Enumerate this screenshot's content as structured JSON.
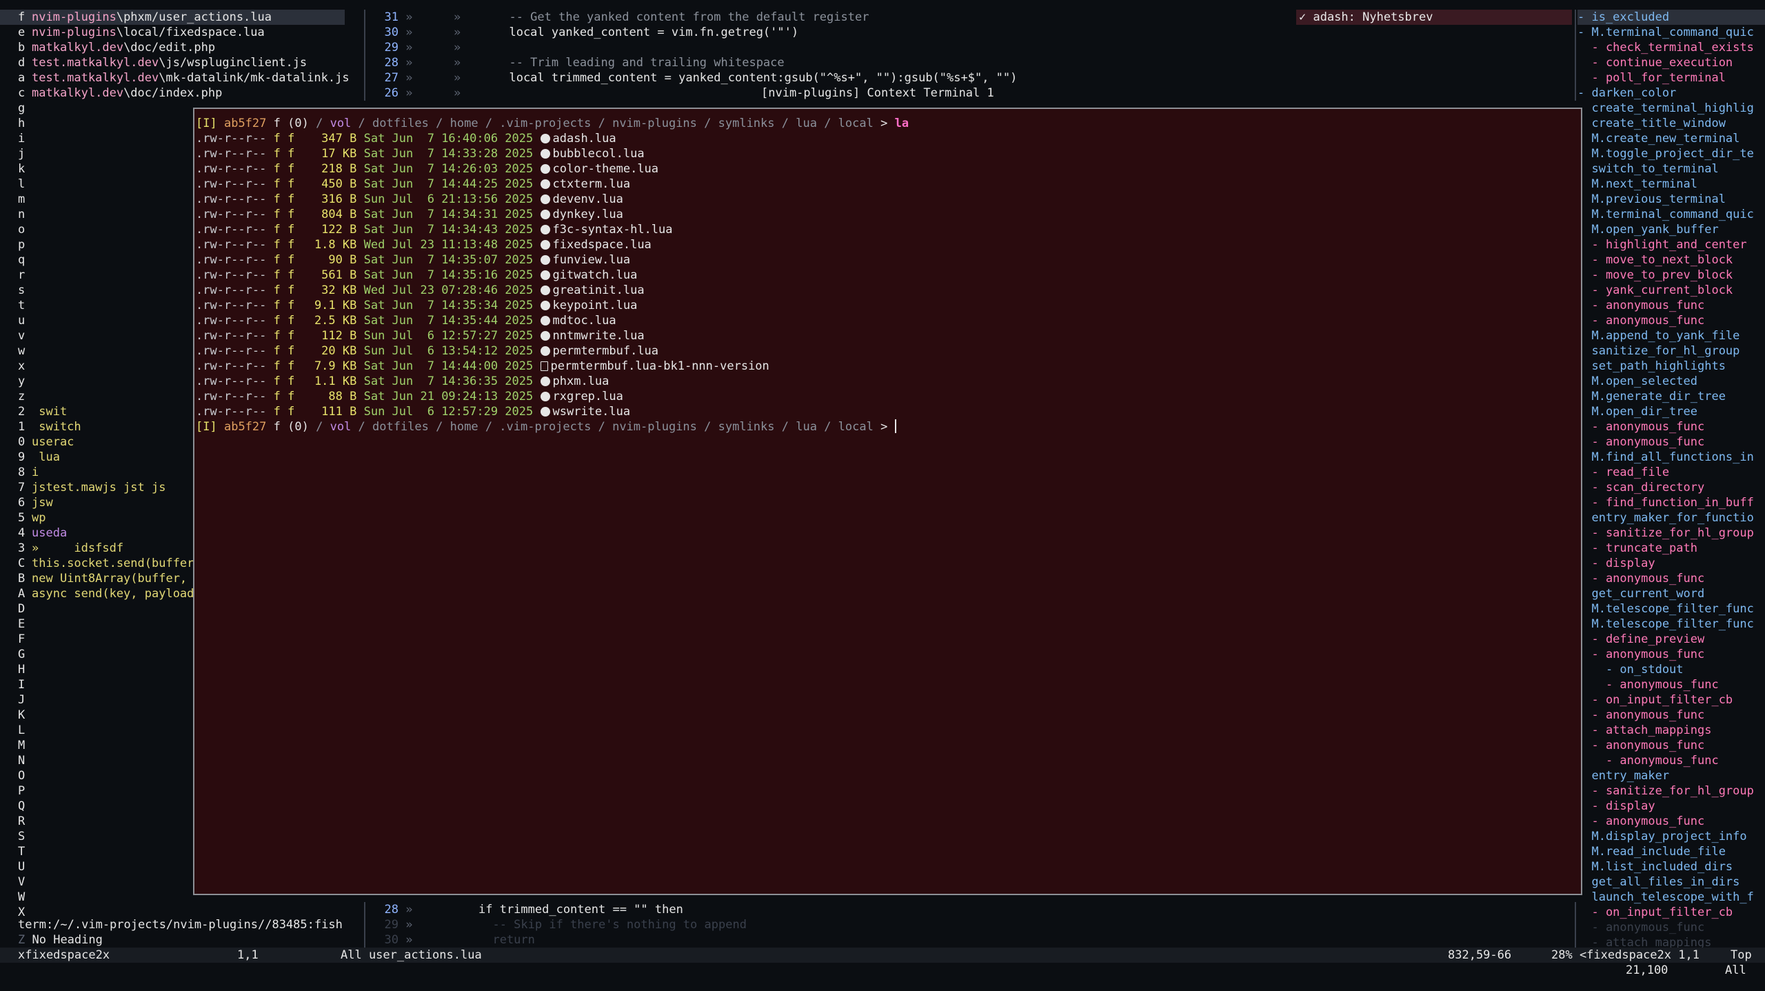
{
  "left_buffers": [
    {
      "key": "f",
      "path_a": "nvim-plugins",
      "path_b": "\\phxm/user_actions.lua",
      "selected": true
    },
    {
      "key": "e",
      "path_a": "nvim-plugins",
      "path_b": "\\local/fixedspace.lua"
    },
    {
      "key": "b",
      "path_a": "matkalkyl.dev",
      "path_b": "\\doc/edit.php"
    },
    {
      "key": "d",
      "path_a": "test.matkalkyl.dev",
      "path_b": "\\js/wspluginclient.js"
    },
    {
      "key": "a",
      "path_a": "test.matkalkyl.dev",
      "path_b": "\\mk-datalink/mk-datalink.js"
    },
    {
      "key": "c",
      "path_a": "matkalkyl.dev",
      "path_b": "\\doc/index.php"
    }
  ],
  "left_keys": [
    "g",
    "h",
    "i",
    "j",
    "k",
    "l",
    "m",
    "n",
    "o",
    "p",
    "q",
    "r",
    "s",
    "t",
    "u",
    "v",
    "w",
    "x",
    "y",
    "z"
  ],
  "left_entries": [
    {
      "key": "2",
      "text": " swit",
      "color": "yellow"
    },
    {
      "key": "1",
      "text": " switch",
      "color": "yellow"
    },
    {
      "key": "0",
      "text": "userac",
      "color": "yellow"
    },
    {
      "key": "9",
      "text": " lua",
      "color": "yellow"
    },
    {
      "key": "8",
      "text": "i",
      "color": "yellow"
    },
    {
      "key": "7",
      "text": "jstest.mawjs jst js",
      "color": "yellow"
    },
    {
      "key": "6",
      "text": "jsw",
      "color": "yellow"
    },
    {
      "key": "5",
      "text": "wp",
      "color": "yellow"
    },
    {
      "key": "4",
      "text": "useda",
      "color": "purple"
    },
    {
      "key": "3",
      "text": "»     idsfsdf",
      "color": "yellow"
    },
    {
      "key": "C",
      "text": "this.socket.send(buffer",
      "color": "yellow"
    },
    {
      "key": "B",
      "text": "new Uint8Array(buffer,",
      "color": "yellow"
    },
    {
      "key": "A",
      "text": "async send(key, payload",
      "color": "yellow"
    }
  ],
  "left_keys2": [
    "D",
    "E",
    "F",
    "G",
    "H",
    "I",
    "J",
    "K",
    "L",
    "M",
    "N",
    "O",
    "P",
    "Q",
    "R",
    "S",
    "T",
    "U",
    "V",
    "W",
    "X"
  ],
  "term_path_line": "term:/~/.vim-projects/nvim-plugins//83485:fish",
  "no_heading": "No Heading",
  "no_heading_key": "Z",
  "editor_top": [
    {
      "ln": "31",
      "code": "  -- Get the yanked content from the default register",
      "kind": "comment"
    },
    {
      "ln": "30",
      "code": "  local yanked_content = vim.fn.getreg('\"')",
      "kind": "code"
    },
    {
      "ln": "29",
      "code": "",
      "kind": "code"
    },
    {
      "ln": "28",
      "code": "  -- Trim leading and trailing whitespace",
      "kind": "comment"
    },
    {
      "ln": "27",
      "code": "  local trimmed_content = yanked_content:gsub(\"^%s+\", \"\"):gsub(\"%s+$\", \"\")",
      "kind": "code"
    },
    {
      "ln": "26",
      "code": "",
      "kind": "code"
    }
  ],
  "notify": "✓ adash: Nyhetsbrev",
  "terminal": {
    "title": "[nvim-plugins] Context Terminal 1",
    "prompt": {
      "mode": "[I]",
      "hash": "ab5f27",
      "flag": "f",
      "status": "(0)",
      "path": [
        "vol",
        "dotfiles",
        "home",
        ".vim-projects",
        "nvim-plugins",
        "symlinks",
        "lua",
        "local"
      ],
      "command": "la"
    },
    "files": [
      {
        "perm": ".rw-r--r--",
        "u": "f",
        "g": "f",
        "size": "347 B",
        "date": "Sat Jun  7 16:40:06 2025",
        "name": "adash.lua",
        "icon": "lua"
      },
      {
        "perm": ".rw-r--r--",
        "u": "f",
        "g": "f",
        "size": " 17 KB",
        "date": "Sat Jun  7 14:33:28 2025",
        "name": "bubblecol.lua",
        "icon": "lua"
      },
      {
        "perm": ".rw-r--r--",
        "u": "f",
        "g": "f",
        "size": "218 B",
        "date": "Sat Jun  7 14:26:03 2025",
        "name": "color-theme.lua",
        "icon": "lua"
      },
      {
        "perm": ".rw-r--r--",
        "u": "f",
        "g": "f",
        "size": "450 B",
        "date": "Sat Jun  7 14:44:25 2025",
        "name": "ctxterm.lua",
        "icon": "lua"
      },
      {
        "perm": ".rw-r--r--",
        "u": "f",
        "g": "f",
        "size": "316 B",
        "date": "Sun Jul  6 21:13:56 2025",
        "name": "devenv.lua",
        "icon": "lua"
      },
      {
        "perm": ".rw-r--r--",
        "u": "f",
        "g": "f",
        "size": "804 B",
        "date": "Sat Jun  7 14:34:31 2025",
        "name": "dynkey.lua",
        "icon": "lua"
      },
      {
        "perm": ".rw-r--r--",
        "u": "f",
        "g": "f",
        "size": "122 B",
        "date": "Sat Jun  7 14:34:43 2025",
        "name": "f3c-syntax-hl.lua",
        "icon": "lua"
      },
      {
        "perm": ".rw-r--r--",
        "u": "f",
        "g": "f",
        "size": "1.8 KB",
        "date": "Wed Jul 23 11:13:48 2025",
        "name": "fixedspace.lua",
        "icon": "lua"
      },
      {
        "perm": ".rw-r--r--",
        "u": "f",
        "g": "f",
        "size": " 90 B",
        "date": "Sat Jun  7 14:35:07 2025",
        "name": "funview.lua",
        "icon": "lua"
      },
      {
        "perm": ".rw-r--r--",
        "u": "f",
        "g": "f",
        "size": "561 B",
        "date": "Sat Jun  7 14:35:16 2025",
        "name": "gitwatch.lua",
        "icon": "lua"
      },
      {
        "perm": ".rw-r--r--",
        "u": "f",
        "g": "f",
        "size": " 32 KB",
        "date": "Wed Jul 23 07:28:46 2025",
        "name": "greatinit.lua",
        "icon": "lua"
      },
      {
        "perm": ".rw-r--r--",
        "u": "f",
        "g": "f",
        "size": "9.1 KB",
        "date": "Sat Jun  7 14:35:34 2025",
        "name": "keypoint.lua",
        "icon": "lua"
      },
      {
        "perm": ".rw-r--r--",
        "u": "f",
        "g": "f",
        "size": "2.5 KB",
        "date": "Sat Jun  7 14:35:44 2025",
        "name": "mdtoc.lua",
        "icon": "lua"
      },
      {
        "perm": ".rw-r--r--",
        "u": "f",
        "g": "f",
        "size": "112 B",
        "date": "Sun Jul  6 12:57:27 2025",
        "name": "nntmwrite.lua",
        "icon": "lua"
      },
      {
        "perm": ".rw-r--r--",
        "u": "f",
        "g": "f",
        "size": " 20 KB",
        "date": "Sun Jul  6 13:54:12 2025",
        "name": "permtermbuf.lua",
        "icon": "lua"
      },
      {
        "perm": ".rw-r--r--",
        "u": "f",
        "g": "f",
        "size": "7.9 KB",
        "date": "Sat Jun  7 14:44:00 2025",
        "name": "permtermbuf.lua-bk1-nnn-version",
        "icon": "doc"
      },
      {
        "perm": ".rw-r--r--",
        "u": "f",
        "g": "f",
        "size": "1.1 KB",
        "date": "Sat Jun  7 14:36:35 2025",
        "name": "phxm.lua",
        "icon": "lua"
      },
      {
        "perm": ".rw-r--r--",
        "u": "f",
        "g": "f",
        "size": " 88 B",
        "date": "Sat Jun 21 09:24:13 2025",
        "name": "rxgrep.lua",
        "icon": "lua"
      },
      {
        "perm": ".rw-r--r--",
        "u": "f",
        "g": "f",
        "size": "111 B",
        "date": "Sun Jul  6 12:57:29 2025",
        "name": "wswrite.lua",
        "icon": "lua"
      }
    ]
  },
  "editor_bottom": [
    {
      "ln": "28",
      "code": "if trimmed_content == \"\" then",
      "kind": "code"
    },
    {
      "ln": "29",
      "code": "  -- Skip if there's nothing to append",
      "kind": "faded"
    },
    {
      "ln": "30",
      "code": "  return",
      "kind": "faded"
    }
  ],
  "outline": [
    {
      "text": "- is_excluded",
      "kind": "top",
      "selected": true
    },
    {
      "text": "- M.terminal_command_quic",
      "kind": "top"
    },
    {
      "text": "  - check_terminal_exists",
      "kind": "sub"
    },
    {
      "text": "  - continue_execution",
      "kind": "sub"
    },
    {
      "text": "  - poll_for_terminal",
      "kind": "sub"
    },
    {
      "text": "- darken_color",
      "kind": "top"
    },
    {
      "text": "  create_terminal_highlig",
      "kind": "top"
    },
    {
      "text": "  create_title_window",
      "kind": "top"
    },
    {
      "text": "  M.create_new_terminal",
      "kind": "top"
    },
    {
      "text": "  M.toggle_project_dir_te",
      "kind": "top"
    },
    {
      "text": "  switch_to_terminal",
      "kind": "top"
    },
    {
      "text": "  M.next_terminal",
      "kind": "top"
    },
    {
      "text": "  M.previous_terminal",
      "kind": "top"
    },
    {
      "text": "  M.terminal_command_quic",
      "kind": "top"
    },
    {
      "text": "  M.open_yank_buffer",
      "kind": "top"
    },
    {
      "text": "  - highlight_and_center",
      "kind": "sub"
    },
    {
      "text": "  - move_to_next_block",
      "kind": "sub"
    },
    {
      "text": "  - move_to_prev_block",
      "kind": "sub"
    },
    {
      "text": "  - yank_current_block",
      "kind": "sub"
    },
    {
      "text": "  - anonymous_func",
      "kind": "sub"
    },
    {
      "text": "  - anonymous_func",
      "kind": "sub"
    },
    {
      "text": "  M.append_to_yank_file",
      "kind": "top"
    },
    {
      "text": "  sanitize_for_hl_group",
      "kind": "top"
    },
    {
      "text": "  set_path_highlights",
      "kind": "top"
    },
    {
      "text": "  M.open_selected",
      "kind": "top"
    },
    {
      "text": "  M.generate_dir_tree",
      "kind": "top"
    },
    {
      "text": "  M.open_dir_tree",
      "kind": "top"
    },
    {
      "text": "  - anonymous_func",
      "kind": "sub"
    },
    {
      "text": "  - anonymous_func",
      "kind": "sub"
    },
    {
      "text": "  M.find_all_functions_in",
      "kind": "top"
    },
    {
      "text": "  - read_file",
      "kind": "sub"
    },
    {
      "text": "  - scan_directory",
      "kind": "sub"
    },
    {
      "text": "  - find_function_in_buff",
      "kind": "sub"
    },
    {
      "text": "  entry_maker_for_functio",
      "kind": "top"
    },
    {
      "text": "  - sanitize_for_hl_group",
      "kind": "sub"
    },
    {
      "text": "  - truncate_path",
      "kind": "sub"
    },
    {
      "text": "  - display",
      "kind": "sub"
    },
    {
      "text": "  - anonymous_func",
      "kind": "sub"
    },
    {
      "text": "  get_current_word",
      "kind": "top"
    },
    {
      "text": "  M.telescope_filter_func",
      "kind": "top"
    },
    {
      "text": "  M.telescope_filter_func",
      "kind": "top"
    },
    {
      "text": "  - define_preview",
      "kind": "sub"
    },
    {
      "text": "  - anonymous_func",
      "kind": "sub"
    },
    {
      "text": "    - on_stdout",
      "kind": "top"
    },
    {
      "text": "    - anonymous_func",
      "kind": "sub"
    },
    {
      "text": "  - on_input_filter_cb",
      "kind": "sub"
    },
    {
      "text": "  - anonymous_func",
      "kind": "sub"
    },
    {
      "text": "  - attach_mappings",
      "kind": "sub"
    },
    {
      "text": "  - anonymous_func",
      "kind": "sub"
    },
    {
      "text": "    - anonymous_func",
      "kind": "sub"
    },
    {
      "text": "  entry_maker",
      "kind": "top"
    },
    {
      "text": "  - sanitize_for_hl_group",
      "kind": "sub"
    },
    {
      "text": "  - display",
      "kind": "sub"
    },
    {
      "text": "  - anonymous_func",
      "kind": "sub"
    },
    {
      "text": "  M.display_project_info",
      "kind": "top"
    },
    {
      "text": "  M.read_include_file",
      "kind": "top"
    },
    {
      "text": "  M.list_included_dirs",
      "kind": "top"
    },
    {
      "text": "  get_all_files_in_dirs",
      "kind": "top"
    },
    {
      "text": "  launch_telescope_with_f",
      "kind": "top"
    },
    {
      "text": "  - on_input_filter_cb",
      "kind": "sub"
    },
    {
      "text": "  - anonymous_func",
      "kind": "faded"
    },
    {
      "text": "  - attach_mappings",
      "kind": "faded"
    }
  ],
  "statusline": {
    "left_name": "xfixedspace2x",
    "left_pos": "1,1",
    "mid": "All user_actions.lua",
    "right_pos": "832,59-66",
    "right_pct": "28% <fixedspace2x 1,1",
    "right_top": "Top",
    "row2_pos": "21,100",
    "row2_all": "All"
  }
}
